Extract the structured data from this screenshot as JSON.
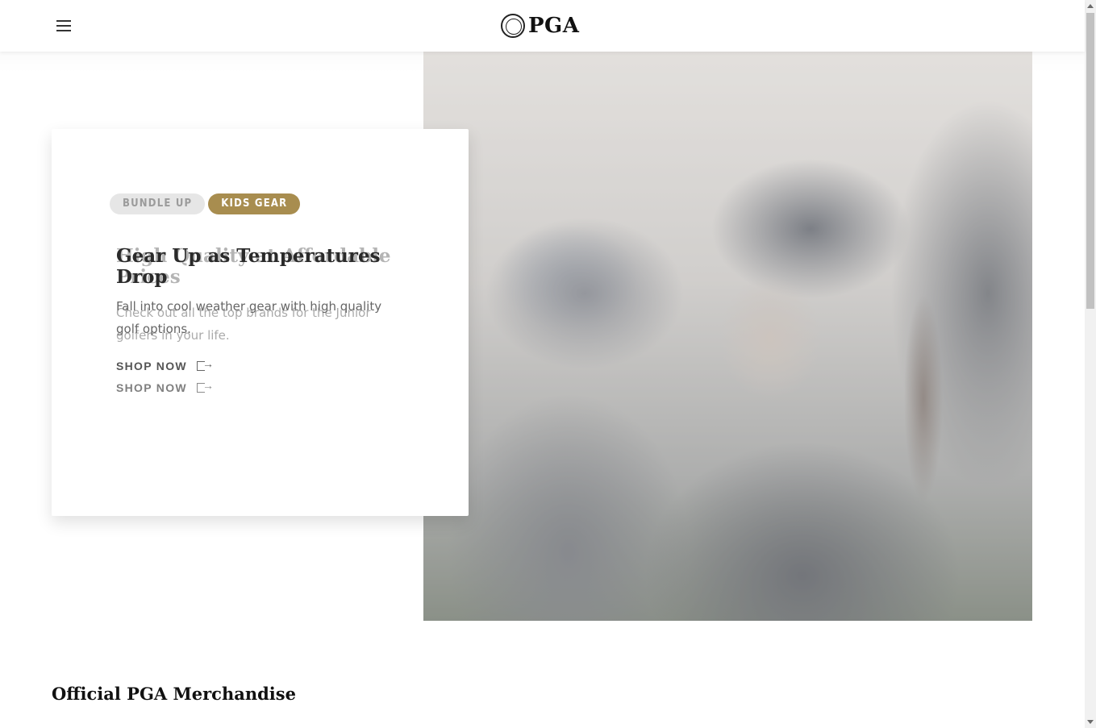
{
  "header": {
    "menu_icon": "hamburger-menu-icon",
    "logo_text": "PGA",
    "logo_icon": "pga-seal-icon"
  },
  "hero": {
    "tags": [
      {
        "label": "BUNDLE UP",
        "active": false
      },
      {
        "label": "KIDS GEAR",
        "active": true
      }
    ],
    "slides": [
      {
        "title": "Gear Up as Temperatures Drop",
        "description": "Fall into cool weather gear with high quality golf options.",
        "cta": "SHOP NOW"
      },
      {
        "title": "High Quality at Affordable Prices",
        "description": "Check out all the top brands for the Junior golfers in your life.",
        "cta": "SHOP NOW"
      }
    ],
    "cta_icon": "arrow-right-icon"
  },
  "section": {
    "title": "Official PGA Merchandise"
  },
  "colors": {
    "accent_gold": "#a88d4f",
    "tag_inactive_bg": "#e6e6e6"
  }
}
